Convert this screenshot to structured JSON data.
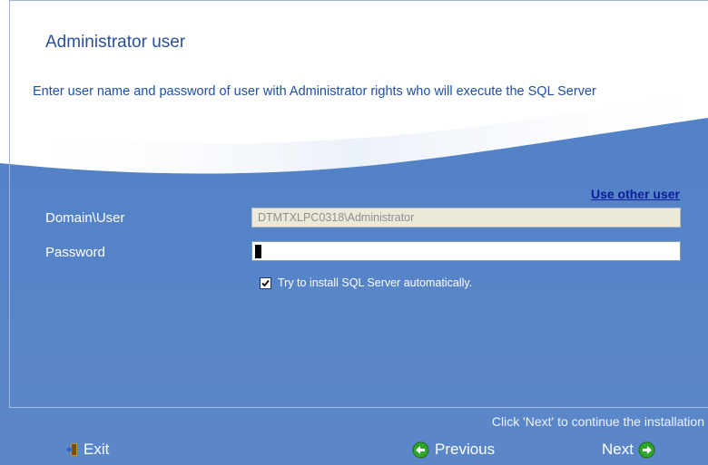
{
  "header": {
    "title": "Administrator user",
    "instruction": "Enter user name and password of user with Administrator rights who will execute the SQL Server"
  },
  "form": {
    "use_other_user": "Use other user",
    "domain_label": "Domain\\User",
    "domain_value": "DTMTXLPC0318\\Administrator",
    "password_label": "Password",
    "password_value": "",
    "auto_install_checked": true,
    "auto_install_label": "Try to install SQL Server automatically."
  },
  "footer": {
    "hint": "Click 'Next' to continue the installation",
    "exit_label": "Exit",
    "previous_label": "Previous",
    "next_label": "Next"
  },
  "colors": {
    "background_blue": "#5b87c9",
    "title_blue": "#2a4f9a",
    "link_blue": "#0a1d9a",
    "button_icon_green": "#2fa52a"
  },
  "icons": {
    "exit": "exit-door-icon",
    "previous": "arrow-left-circle-icon",
    "next": "arrow-right-circle-icon",
    "checkbox": "checkmark-icon"
  }
}
